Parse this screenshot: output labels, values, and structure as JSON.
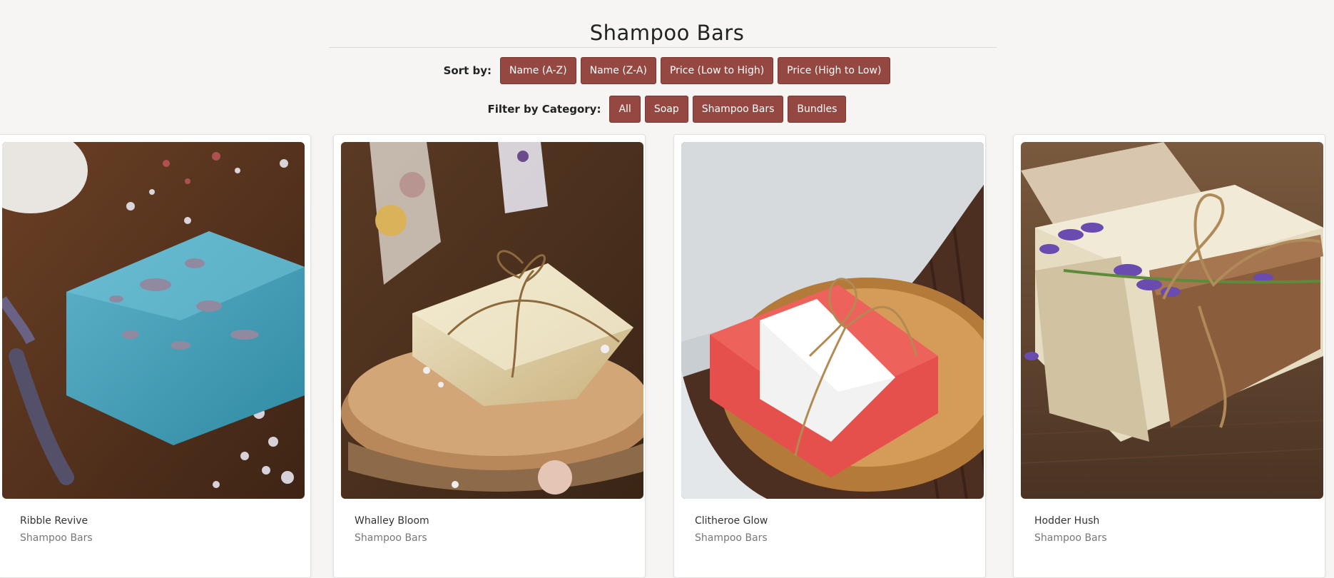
{
  "page": {
    "title": "Shampoo Bars"
  },
  "sort": {
    "label": "Sort by:",
    "options": [
      "Name (A-Z)",
      "Name (Z-A)",
      "Price (Low to High)",
      "Price (High to Low)"
    ]
  },
  "filter": {
    "label": "Filter by Category:",
    "options": [
      "All",
      "Soap",
      "Shampoo Bars",
      "Bundles"
    ]
  },
  "colors": {
    "accent": "#954741",
    "background": "#f6f5f3"
  },
  "products": [
    {
      "name": "Ribble Revive",
      "category": "Shampoo Bars",
      "image": "blue soap bar with lavender and salt"
    },
    {
      "name": "Whalley Bloom",
      "category": "Shampoo Bars",
      "image": "cream soap bar tied with twine on wood slice"
    },
    {
      "name": "Clitheroe Glow",
      "category": "Shampoo Bars",
      "image": "red and white soap in wooden dish"
    },
    {
      "name": "Hodder Hush",
      "category": "Shampoo Bars",
      "image": "soap bars with lavender and twine"
    }
  ]
}
